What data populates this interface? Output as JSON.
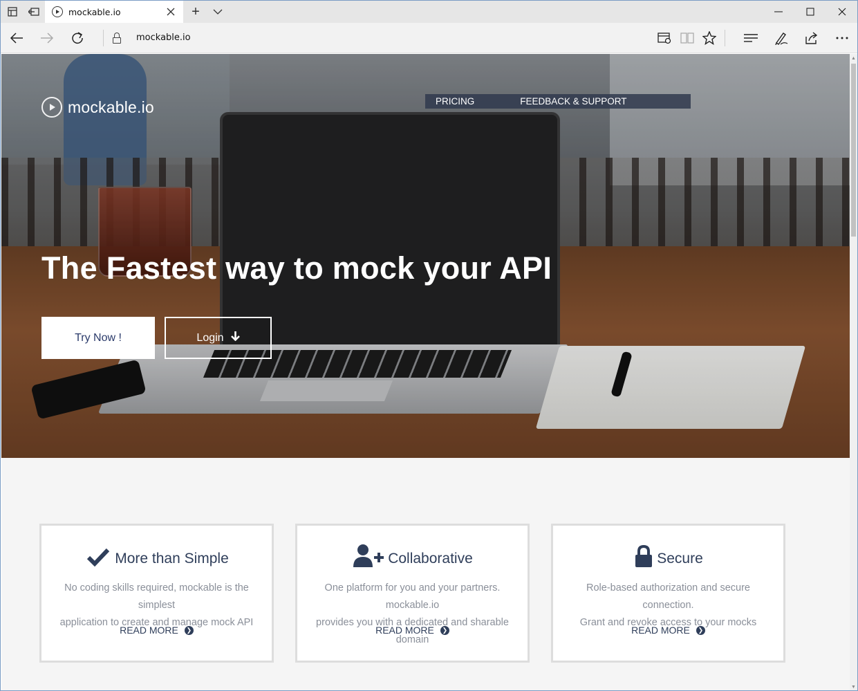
{
  "browser": {
    "tab_title": "mockable.io",
    "url": "mockable.io",
    "new_tab_symbol": "+",
    "tab_list_symbol": "⌄",
    "minimize_symbol": "—",
    "maximize_symbol": "☐",
    "close_symbol": "✕"
  },
  "site": {
    "brand": "mockable.io",
    "nav": {
      "pricing": "PRICING",
      "feedback": "FEEDBACK & SUPPORT"
    },
    "hero": {
      "headline": "The Fastest way to mock your API",
      "try_label": "Try Now !",
      "login_label": "Login"
    },
    "features": [
      {
        "icon": "checkmark-icon",
        "title": "More than Simple",
        "desc_line1": "No coding skills required, mockable is the simplest",
        "desc_line2": "application to create and manage mock API",
        "more": "READ MORE"
      },
      {
        "icon": "add-user-icon",
        "title": "Collaborative",
        "desc_line1": "One platform for you and your partners. mockable.io",
        "desc_line2": "provides you with a dedicated and sharable domain",
        "more": "READ MORE"
      },
      {
        "icon": "lock-icon",
        "title": "Secure",
        "desc_line1": "Role-based authorization and secure connection.",
        "desc_line2": "Grant and revoke access to your mocks",
        "more": "READ MORE"
      }
    ]
  },
  "colors": {
    "accent": "#2f3e5a",
    "nav_bar": "#303a4e",
    "card_border": "#dddddd"
  }
}
